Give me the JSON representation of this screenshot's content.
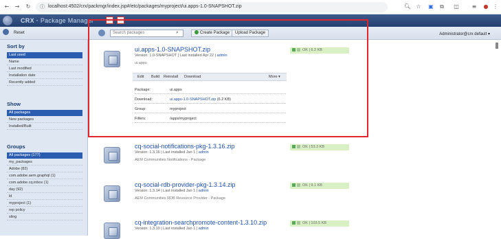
{
  "browser": {
    "url": "localhost:4502/crx/packmgr/index.jsp#/etc/packages/myproject/ui.apps-1.0-SNAPSHOT.zip",
    "icons": [
      "back-icon",
      "forward-icon",
      "reload-icon",
      "site-info-icon",
      "zoom-icon",
      "bookmark-star-icon",
      "extension-icon",
      "extensions-puzzle-icon",
      "side-panel-icon",
      "profile-icon",
      "more-menu-icon"
    ]
  },
  "header": {
    "brand": "CRX",
    "title": "Package Manager"
  },
  "toolbar": {
    "reset_label": "Reset",
    "search_placeholder": "Search packages",
    "create_label": "Create Package",
    "upload_label": "Upload Package",
    "user_label": "Administrator@crx default"
  },
  "sidebar": {
    "sort_heading": "Sort by",
    "sort_items": [
      "Last used",
      "Name",
      "Last modified",
      "Installation date",
      "Recently added"
    ],
    "show_heading": "Show",
    "show_items": [
      "All packages",
      "New packages",
      "Installed/Built"
    ],
    "groups_heading": "Groups",
    "group_items": [
      "All packages (177)",
      "my_packages",
      "Adobe (82)",
      "com.adobe.aem.graphql (1)",
      "com.adobe.cq.inbox (1)",
      "day (92)",
      "ld",
      "myproject (1)",
      "rep policy",
      "sling"
    ]
  },
  "packages": [
    {
      "name": "ui.apps-1.0-SNAPSHOT.zip",
      "version_prefix": "Version: 1.0-SNAPSHOT | Last installed Apr 22 |",
      "installer": "admin",
      "description": "ui.apps",
      "status": "OK | 6.2 KB",
      "actions": [
        "Edit",
        "Build",
        "Reinstall",
        "Download"
      ],
      "more_label": "More",
      "details": [
        {
          "key": "Package:",
          "value": "ui.apps"
        },
        {
          "key": "Download:",
          "value": "ui.apps-1.0-SNAPSHOT.zip",
          "extra": "(6.2 KB)"
        },
        {
          "key": "Group:",
          "value": "myproject"
        },
        {
          "key": "Filters:",
          "value": "/apps/myproject"
        }
      ]
    },
    {
      "name": "cq-social-notifications-pkg-1.3.16.zip",
      "version_prefix": "Version: 1.3.16 | Last installed Jan 1 |",
      "installer": "admin",
      "description": "AEM Communities Notifications - Package",
      "status": "OK | 53.3 KB"
    },
    {
      "name": "cq-social-rdb-provider-pkg-1.3.14.zip",
      "version_prefix": "Version: 1.3.14 | Last installed Jan 1 |",
      "installer": "admin",
      "description": "AEM Communities RDB Resource Provider - Package",
      "status": "OK | 9.1 KB"
    },
    {
      "name": "cq-integration-searchpromote-content-1.3.10.zip",
      "version_prefix": "Version: 1.3.10 | Last installed Jan 1 |",
      "installer": "admin",
      "status": "OK | 103.5 KB"
    }
  ]
}
